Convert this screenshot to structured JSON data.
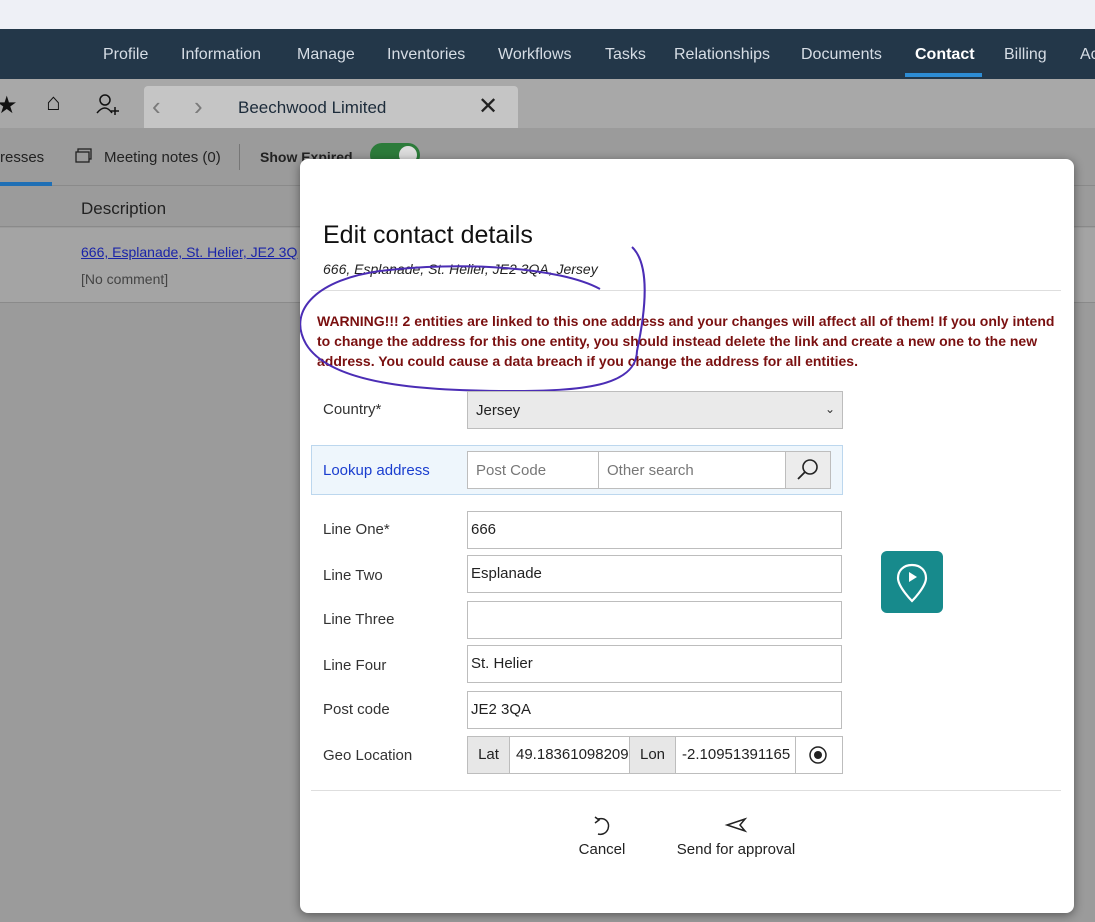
{
  "nav": {
    "items": [
      "Profile",
      "Information",
      "Manage",
      "Inventories",
      "Workflows",
      "Tasks",
      "Relationships",
      "Documents",
      "Contact",
      "Billing",
      "Ac"
    ],
    "active": "Contact"
  },
  "toolbar": {
    "star_icon": "★",
    "home_icon": "⌂",
    "add_user_icon": "person-add",
    "back_icon": "‹",
    "forward_icon": "›",
    "tab_title": "Beechwood Limited",
    "close_icon": "✕"
  },
  "subtabs": {
    "addresses_partial": "resses",
    "meeting_notes": "Meeting notes (0)",
    "show_expired": "Show Expired"
  },
  "table": {
    "header": "Description",
    "row_link": "666, Esplanade, St. Helier, JE2 3Q",
    "row_comment": "[No comment]"
  },
  "modal": {
    "title": "Edit contact details",
    "subtitle": "666, Esplanade, St. Helier, JE2 3QA, Jersey",
    "warning": "WARNING!!! 2 entities are linked to this one address and your changes will affect all of them! If you only intend to change the address for this one entity, you should instead delete the link and create a new one to the new address. You could cause a data breach if you change the address for all entities.",
    "country_label": "Country*",
    "country_value": "Jersey",
    "lookup_label": "Lookup address",
    "postcode_placeholder": "Post Code",
    "other_search_placeholder": "Other search",
    "line1_label": "Line One*",
    "line1_value": "666",
    "line2_label": "Line Two",
    "line2_value": "Esplanade",
    "line3_label": "Line Three",
    "line3_value": "",
    "line4_label": "Line Four",
    "line4_value": "St. Helier",
    "postcode_label": "Post code",
    "postcode_value": "JE2 3QA",
    "geo_label": "Geo Location",
    "lat_label": "Lat",
    "lat_value": "49.18361098209",
    "lon_label": "Lon",
    "lon_value": "-2.10951391165",
    "cancel_label": "Cancel",
    "send_label": "Send for approval"
  },
  "colors": {
    "nav_bg": "#233749",
    "accent": "#2d8cd4",
    "warning": "#7a1010",
    "map_button": "#178a8c",
    "toggle_on": "#2c7b3a"
  }
}
